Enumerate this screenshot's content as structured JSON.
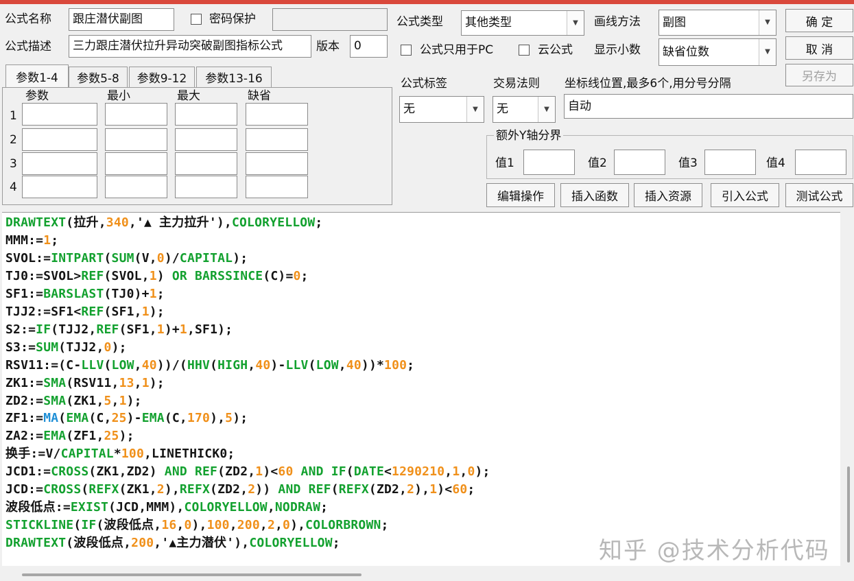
{
  "form": {
    "name_label": "公式名称",
    "name_value": "跟庄潜伏副图",
    "password_label": "密码保护",
    "desc_label": "公式描述",
    "desc_value": "三力跟庄潜伏拉升异动突破副图指标公式",
    "version_label": "版本",
    "version_value": "0",
    "type_label": "公式类型",
    "type_value": "其他类型",
    "draw_label": "画线方法",
    "draw_value": "副图",
    "pc_only_label": "公式只用于PC",
    "cloud_label": "云公式",
    "decimals_label": "显示小数",
    "decimals_value": "缺省位数",
    "tag_label": "公式标签",
    "tag_value": "无",
    "trade_label": "交易法则",
    "trade_value": "无",
    "axis_label": "坐标线位置,最多6个,用分号分隔",
    "axis_value": "自动",
    "yaxis_group_label": "额外Y轴分界",
    "y_labels": [
      "值1",
      "值2",
      "值3",
      "值4"
    ]
  },
  "buttons": {
    "ok": "确  定",
    "cancel": "取  消",
    "save_as": "另存为",
    "edit_ops": "编辑操作",
    "insert_func": "插入函数",
    "insert_res": "插入资源",
    "import_formula": "引入公式",
    "test_formula": "测试公式"
  },
  "tabs": [
    "参数1-4",
    "参数5-8",
    "参数9-12",
    "参数13-16"
  ],
  "params": {
    "headers": [
      "参数",
      "最小",
      "最大",
      "缺省"
    ],
    "rows": [
      "1",
      "2",
      "3",
      "4"
    ]
  },
  "colors": {
    "black": "#141414",
    "green": "#13a12f",
    "orange": "#f0901a",
    "blue": "#1f8fd6",
    "title_bar": "#d9483b"
  },
  "code_lines": [
    [
      [
        "DRAWTEXT",
        "green"
      ],
      [
        "(拉升,",
        "black"
      ],
      [
        "340",
        "orange"
      ],
      [
        ",'▲ 主力拉升'),",
        "black"
      ],
      [
        "COLORYELLOW",
        "green"
      ],
      [
        ";",
        "black"
      ]
    ],
    [
      [
        "MMM:=",
        "black"
      ],
      [
        "1",
        "orange"
      ],
      [
        ";",
        "black"
      ]
    ],
    [
      [
        "SVOL:=",
        "black"
      ],
      [
        "INTPART",
        "green"
      ],
      [
        "(",
        "black"
      ],
      [
        "SUM",
        "green"
      ],
      [
        "(V,",
        "black"
      ],
      [
        "0",
        "orange"
      ],
      [
        ")/",
        "black"
      ],
      [
        "CAPITAL",
        "green"
      ],
      [
        ");",
        "black"
      ]
    ],
    [
      [
        "TJ0:=SVOL>",
        "black"
      ],
      [
        "REF",
        "green"
      ],
      [
        "(SVOL,",
        "black"
      ],
      [
        "1",
        "orange"
      ],
      [
        ") ",
        "black"
      ],
      [
        "OR",
        "green"
      ],
      [
        " ",
        "black"
      ],
      [
        "BARSSINCE",
        "green"
      ],
      [
        "(C)=",
        "black"
      ],
      [
        "0",
        "orange"
      ],
      [
        ";",
        "black"
      ]
    ],
    [
      [
        "SF1:=",
        "black"
      ],
      [
        "BARSLAST",
        "green"
      ],
      [
        "(TJ0)+",
        "black"
      ],
      [
        "1",
        "orange"
      ],
      [
        ";",
        "black"
      ]
    ],
    [
      [
        "TJJ2:=SF1<",
        "black"
      ],
      [
        "REF",
        "green"
      ],
      [
        "(SF1,",
        "black"
      ],
      [
        "1",
        "orange"
      ],
      [
        ");",
        "black"
      ]
    ],
    [
      [
        "S2:=",
        "black"
      ],
      [
        "IF",
        "green"
      ],
      [
        "(TJJ2,",
        "black"
      ],
      [
        "REF",
        "green"
      ],
      [
        "(SF1,",
        "black"
      ],
      [
        "1",
        "orange"
      ],
      [
        ")+",
        "black"
      ],
      [
        "1",
        "orange"
      ],
      [
        ",SF1);",
        "black"
      ]
    ],
    [
      [
        "S3:=",
        "black"
      ],
      [
        "SUM",
        "green"
      ],
      [
        "(TJJ2,",
        "black"
      ],
      [
        "0",
        "orange"
      ],
      [
        ");",
        "black"
      ]
    ],
    [
      [
        "RSV11:=(C-",
        "black"
      ],
      [
        "LLV",
        "green"
      ],
      [
        "(",
        "black"
      ],
      [
        "LOW",
        "green"
      ],
      [
        ",",
        "black"
      ],
      [
        "40",
        "orange"
      ],
      [
        "))/(",
        "black"
      ],
      [
        "HHV",
        "green"
      ],
      [
        "(",
        "black"
      ],
      [
        "HIGH",
        "green"
      ],
      [
        ",",
        "black"
      ],
      [
        "40",
        "orange"
      ],
      [
        ")-",
        "black"
      ],
      [
        "LLV",
        "green"
      ],
      [
        "(",
        "black"
      ],
      [
        "LOW",
        "green"
      ],
      [
        ",",
        "black"
      ],
      [
        "40",
        "orange"
      ],
      [
        "))*",
        "black"
      ],
      [
        "100",
        "orange"
      ],
      [
        ";",
        "black"
      ]
    ],
    [
      [
        "ZK1:=",
        "black"
      ],
      [
        "SMA",
        "green"
      ],
      [
        "(RSV11,",
        "black"
      ],
      [
        "13",
        "orange"
      ],
      [
        ",",
        "black"
      ],
      [
        "1",
        "orange"
      ],
      [
        ");",
        "black"
      ]
    ],
    [
      [
        "ZD2:=",
        "black"
      ],
      [
        "SMA",
        "green"
      ],
      [
        "(ZK1,",
        "black"
      ],
      [
        "5",
        "orange"
      ],
      [
        ",",
        "black"
      ],
      [
        "1",
        "orange"
      ],
      [
        ");",
        "black"
      ]
    ],
    [
      [
        "ZF1:=",
        "black"
      ],
      [
        "MA",
        "blue"
      ],
      [
        "(",
        "black"
      ],
      [
        "EMA",
        "green"
      ],
      [
        "(C,",
        "black"
      ],
      [
        "25",
        "orange"
      ],
      [
        ")-",
        "black"
      ],
      [
        "EMA",
        "green"
      ],
      [
        "(C,",
        "black"
      ],
      [
        "170",
        "orange"
      ],
      [
        "),",
        "black"
      ],
      [
        "5",
        "orange"
      ],
      [
        ");",
        "black"
      ]
    ],
    [
      [
        "ZA2:=",
        "black"
      ],
      [
        "EMA",
        "green"
      ],
      [
        "(ZF1,",
        "black"
      ],
      [
        "25",
        "orange"
      ],
      [
        ");",
        "black"
      ]
    ],
    [
      [
        "换手:=V/",
        "black"
      ],
      [
        "CAPITAL",
        "green"
      ],
      [
        "*",
        "black"
      ],
      [
        "100",
        "orange"
      ],
      [
        ",LINETHICK0;",
        "black"
      ]
    ],
    [
      [
        "JCD1:=",
        "black"
      ],
      [
        "CROSS",
        "green"
      ],
      [
        "(ZK1,ZD2) ",
        "black"
      ],
      [
        "AND",
        "green"
      ],
      [
        " ",
        "black"
      ],
      [
        "REF",
        "green"
      ],
      [
        "(ZD2,",
        "black"
      ],
      [
        "1",
        "orange"
      ],
      [
        ")<",
        "black"
      ],
      [
        "60",
        "orange"
      ],
      [
        " ",
        "black"
      ],
      [
        "AND",
        "green"
      ],
      [
        " ",
        "black"
      ],
      [
        "IF",
        "green"
      ],
      [
        "(",
        "black"
      ],
      [
        "DATE",
        "green"
      ],
      [
        "<",
        "black"
      ],
      [
        "1290210",
        "orange"
      ],
      [
        ",",
        "black"
      ],
      [
        "1",
        "orange"
      ],
      [
        ",",
        "black"
      ],
      [
        "0",
        "orange"
      ],
      [
        ");",
        "black"
      ]
    ],
    [
      [
        "JCD:=",
        "black"
      ],
      [
        "CROSS",
        "green"
      ],
      [
        "(",
        "black"
      ],
      [
        "REFX",
        "green"
      ],
      [
        "(ZK1,",
        "black"
      ],
      [
        "2",
        "orange"
      ],
      [
        "),",
        "black"
      ],
      [
        "REFX",
        "green"
      ],
      [
        "(ZD2,",
        "black"
      ],
      [
        "2",
        "orange"
      ],
      [
        ")) ",
        "black"
      ],
      [
        "AND",
        "green"
      ],
      [
        " ",
        "black"
      ],
      [
        "REF",
        "green"
      ],
      [
        "(",
        "black"
      ],
      [
        "REFX",
        "green"
      ],
      [
        "(ZD2,",
        "black"
      ],
      [
        "2",
        "orange"
      ],
      [
        "),",
        "black"
      ],
      [
        "1",
        "orange"
      ],
      [
        ")<",
        "black"
      ],
      [
        "60",
        "orange"
      ],
      [
        ";",
        "black"
      ]
    ],
    [
      [
        "波段低点:=",
        "black"
      ],
      [
        "EXIST",
        "green"
      ],
      [
        "(JCD,MMM),",
        "black"
      ],
      [
        "COLORYELLOW",
        "green"
      ],
      [
        ",",
        "black"
      ],
      [
        "NODRAW",
        "green"
      ],
      [
        ";",
        "black"
      ]
    ],
    [
      [
        "STICKLINE",
        "green"
      ],
      [
        "(",
        "black"
      ],
      [
        "IF",
        "green"
      ],
      [
        "(波段低点,",
        "black"
      ],
      [
        "16",
        "orange"
      ],
      [
        ",",
        "black"
      ],
      [
        "0",
        "orange"
      ],
      [
        "),",
        "black"
      ],
      [
        "100",
        "orange"
      ],
      [
        ",",
        "black"
      ],
      [
        "200",
        "orange"
      ],
      [
        ",",
        "black"
      ],
      [
        "2",
        "orange"
      ],
      [
        ",",
        "black"
      ],
      [
        "0",
        "orange"
      ],
      [
        "),",
        "black"
      ],
      [
        "COLORBROWN",
        "green"
      ],
      [
        ";",
        "black"
      ]
    ],
    [
      [
        "DRAWTEXT",
        "green"
      ],
      [
        "(波段低点,",
        "black"
      ],
      [
        "200",
        "orange"
      ],
      [
        ",'▲主力潜伏'),",
        "black"
      ],
      [
        "COLORYELLOW",
        "green"
      ],
      [
        ";",
        "black"
      ]
    ]
  ],
  "watermark": "知乎 @技术分析代码"
}
